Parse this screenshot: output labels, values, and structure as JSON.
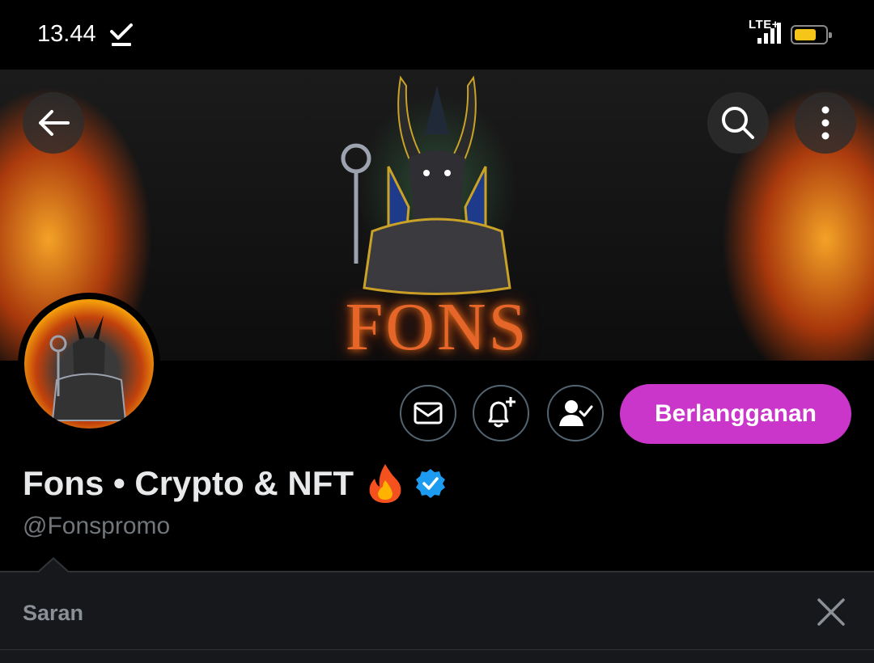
{
  "status_bar": {
    "time": "13.44",
    "network": "LTE+",
    "download_icon": "download-done-icon",
    "battery_color": "#f5c518"
  },
  "banner": {
    "title": "FONS",
    "back_icon": "arrow-left-icon",
    "search_icon": "search-icon",
    "more_icon": "more-vertical-icon"
  },
  "profile": {
    "display_name": "Fons • Crypto & NFT",
    "handle": "@Fonspromo",
    "verified": true,
    "verified_color": "#1d9bf0"
  },
  "actions": {
    "message_icon": "mail-icon",
    "notify_icon": "bell-plus-icon",
    "following_icon": "person-check-icon",
    "subscribe_label": "Berlangganan",
    "subscribe_color": "#c936c9"
  },
  "suggestions": {
    "label": "Saran",
    "close_icon": "close-icon"
  }
}
